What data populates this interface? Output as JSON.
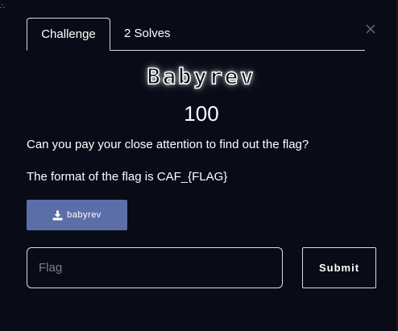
{
  "corner_mark": "∴",
  "tabs": [
    {
      "label": "Challenge",
      "active": true
    },
    {
      "label": "2 Solves",
      "active": false
    }
  ],
  "challenge": {
    "name": "Babyrev",
    "points": "100",
    "description_lines": [
      "Can you pay your close attention to find out the flag?",
      "The format of the flag is CAF_{FLAG}"
    ]
  },
  "download": {
    "label": "babyrev",
    "icon": "download-icon"
  },
  "flag_input": {
    "placeholder": "Flag",
    "value": ""
  },
  "submit": {
    "label": "Submit"
  },
  "colors": {
    "background": "#090c17",
    "download_button": "#5c6ea8",
    "border": "#d9dbe0"
  }
}
